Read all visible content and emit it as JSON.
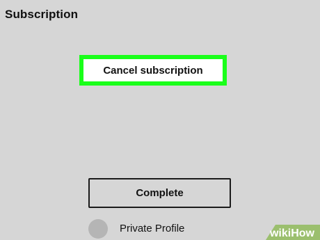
{
  "section": {
    "title": "Subscription"
  },
  "actions": {
    "cancel_label": "Cancel subscription",
    "complete_label": "Complete"
  },
  "privacy": {
    "private_profile_label": "Private Profile",
    "private_profile_checked": false
  },
  "watermark": {
    "text": "wikiHow"
  },
  "colors": {
    "background": "#d6d6d6",
    "highlight": "#1aff1a",
    "watermark": "#9bbf6e"
  }
}
